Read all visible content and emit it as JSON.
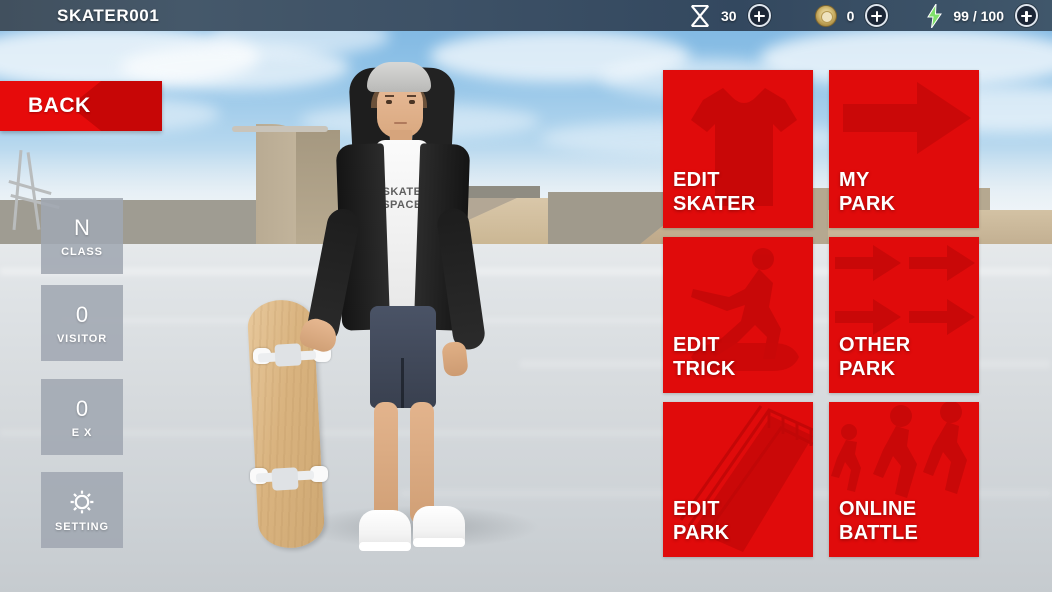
{
  "topbar": {
    "title": "SKATER001",
    "resources": [
      {
        "icon": "x-token-icon",
        "value": "30",
        "add_label": "+"
      },
      {
        "icon": "coin-icon",
        "value": "0",
        "add_label": "+"
      },
      {
        "icon": "energy-bolt-icon",
        "value": "99 / 100",
        "add_label": "+"
      }
    ]
  },
  "back_button": {
    "label": "BACK",
    "icon": "left-arrow-icon"
  },
  "left_stats": [
    {
      "value": "N",
      "label": "CLASS",
      "icon": ""
    },
    {
      "value": "0",
      "label": "VISITOR",
      "icon": ""
    },
    {
      "value": "0",
      "label": "E X",
      "icon": ""
    },
    {
      "value": "",
      "label": "SETTING",
      "icon": "gear-icon"
    }
  ],
  "menu_tiles": [
    {
      "label": "EDIT\nSKATER",
      "art": "tshirt-silhouette"
    },
    {
      "label": "MY\nPARK",
      "art": "right-arrow-silhouette"
    },
    {
      "label": "EDIT\nTRICK",
      "art": "skater-silhouette"
    },
    {
      "label": "OTHER\nPARK",
      "art": "multi-arrow-silhouette"
    },
    {
      "label": "EDIT\nPARK",
      "art": "ramp-rail-silhouette"
    },
    {
      "label": "ONLINE\nBATTLE",
      "art": "runners-silhouette"
    }
  ],
  "character": {
    "shirt_text": "SKATE\nSPACE"
  },
  "colors": {
    "accent_red": "#e00b0b",
    "back_red": "#e60b0b",
    "arrow_dark_red": "#c70606",
    "stat_gray": "#a0a7b2",
    "topbar_blue": "#3d5166",
    "energy_green": "#7fe06b",
    "coin_gold": "#d9c27c"
  }
}
